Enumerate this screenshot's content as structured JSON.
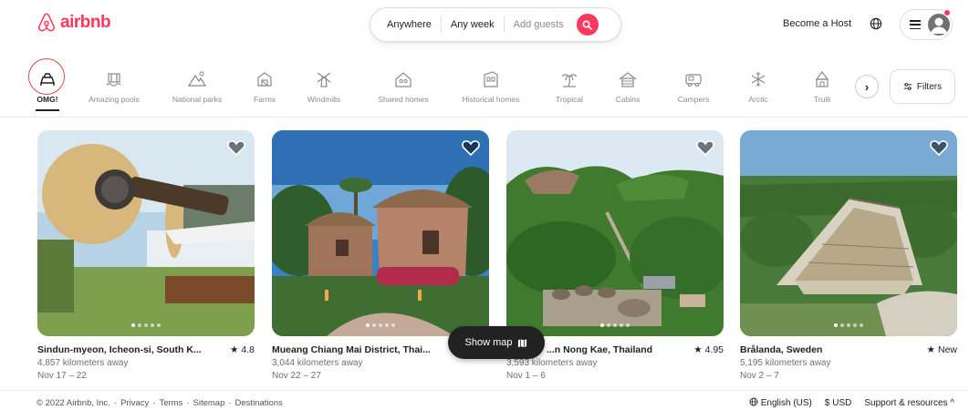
{
  "brand": {
    "name": "airbnb",
    "color": "#FF385C"
  },
  "search": {
    "where": "Anywhere",
    "when": "Any week",
    "guests_placeholder": "Add guests",
    "button_icon": "search-icon"
  },
  "header": {
    "become_host": "Become a Host",
    "globe_icon": "globe-icon",
    "menu_icon": "hamburger-icon",
    "avatar_icon": "user-avatar-icon"
  },
  "categories": [
    {
      "label": "OMG!",
      "icon": "omg-icon",
      "active": true
    },
    {
      "label": "Amazing pools",
      "icon": "pool-icon"
    },
    {
      "label": "National parks",
      "icon": "mountain-icon"
    },
    {
      "label": "Farms",
      "icon": "barn-icon"
    },
    {
      "label": "Windmills",
      "icon": "windmill-icon"
    },
    {
      "label": "Shared homes",
      "icon": "shared-home-icon"
    },
    {
      "label": "Historical homes",
      "icon": "historical-home-icon"
    },
    {
      "label": "Tropical",
      "icon": "palm-tree-icon"
    },
    {
      "label": "Cabins",
      "icon": "cabin-icon"
    },
    {
      "label": "Campers",
      "icon": "camper-icon"
    },
    {
      "label": "Arctic",
      "icon": "snowflake-icon"
    },
    {
      "label": "Trulli",
      "icon": "trulli-icon"
    }
  ],
  "filters_label": "Filters",
  "listings": [
    {
      "location": "Sindun-myeon, Icheon-si, South K...",
      "rating": "4.8",
      "distance": "4,857 kilometers away",
      "dates": "Nov 17 – 22"
    },
    {
      "location": "Mueang Chiang Mai District, Thai...",
      "rating": "",
      "distance": "3,044 kilometers away",
      "dates": "Nov 22 – 27"
    },
    {
      "location": "...n Nong Kae, Thailand",
      "rating": "4.95",
      "distance": "3,593 kilometers away",
      "dates": "Nov 1 – 6"
    },
    {
      "location": "Brålanda, Sweden",
      "rating": "New",
      "distance": "5,195 kilometers away",
      "dates": "Nov 2 – 7"
    }
  ],
  "show_map": "Show map",
  "footer": {
    "copyright": "© 2022 Airbnb, Inc.",
    "links": [
      "Privacy",
      "Terms",
      "Sitemap",
      "Destinations"
    ],
    "language": "English (US)",
    "currency": "$ USD",
    "support": "Support & resources"
  }
}
